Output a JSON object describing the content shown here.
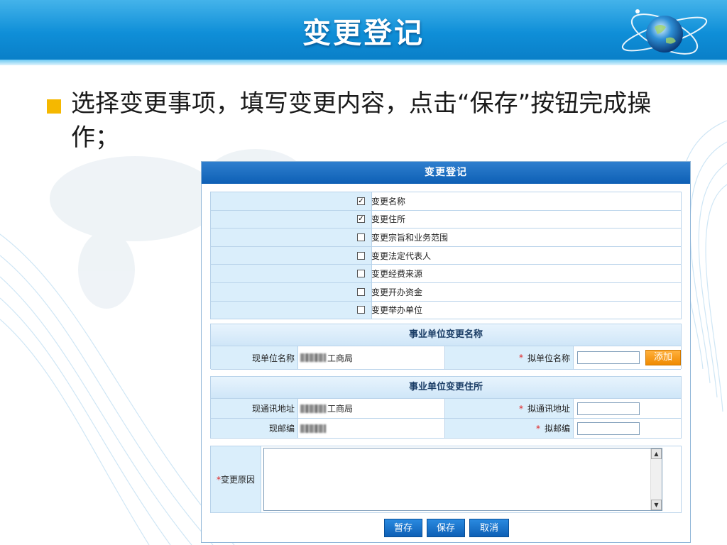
{
  "slide": {
    "title": "变更登记",
    "bullet": "选择变更事项，填写变更内容，点击“保存”按钮完成操作；"
  },
  "form": {
    "title": "变更登记",
    "items": [
      {
        "label": "变更名称",
        "checked": true
      },
      {
        "label": "变更住所",
        "checked": true
      },
      {
        "label": "变更宗旨和业务范围",
        "checked": false
      },
      {
        "label": "变更法定代表人",
        "checked": false
      },
      {
        "label": "变更经费来源",
        "checked": false
      },
      {
        "label": "变更开办资金",
        "checked": false
      },
      {
        "label": "变更举办单位",
        "checked": false
      }
    ],
    "name_section": {
      "title": "事业单位变更名称",
      "current_label": "现单位名称",
      "current_value": "工商局",
      "proposed_label": "拟单位名称",
      "add_button": "添加"
    },
    "address_section": {
      "title": "事业单位变更住所",
      "current_address_label": "现通讯地址",
      "current_address_value": "工商局",
      "proposed_address_label": "拟通讯地址",
      "current_zip_label": "现邮编",
      "proposed_zip_label": "拟邮编"
    },
    "reason": {
      "label": "变更原因"
    },
    "buttons": {
      "temp_save": "暂存",
      "save": "保存",
      "cancel": "取消"
    }
  },
  "colors": {
    "header": "#0f8fd8",
    "bullet": "#f5b800",
    "form_header": "#0d5fb5",
    "add_button": "#f08a00",
    "required": "#e02020"
  }
}
